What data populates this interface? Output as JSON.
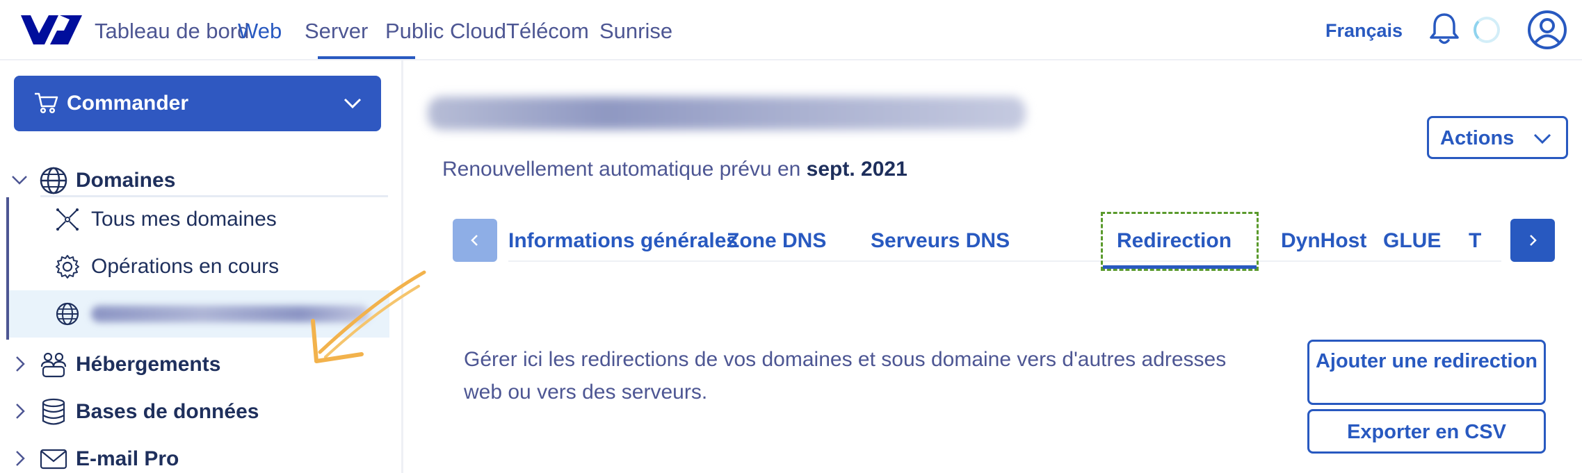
{
  "topnav": {
    "items": [
      {
        "label": "Tableau de bord",
        "active": false
      },
      {
        "label": "Web",
        "active": true
      },
      {
        "label": "Server",
        "active": false
      },
      {
        "label": "Public Cloud",
        "active": false
      },
      {
        "label": "Télécom",
        "active": false
      },
      {
        "label": "Sunrise",
        "active": false
      }
    ],
    "language": "Français",
    "icons": [
      "ovh-logo-icon",
      "bell-icon",
      "loading-spinner-icon",
      "user-account-icon"
    ]
  },
  "sidebar": {
    "order_button": {
      "label": "Commander",
      "icon": "cart-icon",
      "chevron": "chevron-down-icon"
    },
    "sections": [
      {
        "label": "Domaines",
        "icon": "globe-icon",
        "expanded": true,
        "children": [
          {
            "label": "Tous mes domaines",
            "icon": "network-icon"
          },
          {
            "label": "Opérations en cours",
            "icon": "gear-icon"
          }
        ]
      },
      {
        "label": "Hébergements",
        "icon": "hosting-icon",
        "expanded": false
      },
      {
        "label": "Bases de données",
        "icon": "database-icon",
        "expanded": false
      },
      {
        "label": "E-mail Pro",
        "icon": "envelope-icon",
        "expanded": false
      }
    ]
  },
  "main": {
    "renewal": {
      "prefix": "Renouvellement automatique prévu en ",
      "date": "sept. 2021"
    },
    "actions_button": "Actions",
    "tabs": [
      {
        "label": "Informations générales",
        "active": false
      },
      {
        "label": "Zone DNS",
        "active": false
      },
      {
        "label": "Serveurs DNS",
        "active": false
      },
      {
        "label": "Redirection",
        "active": true
      },
      {
        "label": "DynHost",
        "active": false
      },
      {
        "label": "GLUE",
        "active": false
      },
      {
        "label": "T",
        "active": false
      }
    ],
    "description": "Gérer ici les redirections de vos domaines et sous domaine vers d'autres adresses web ou vers des serveurs.",
    "buttons": {
      "add_redirection": "Ajouter une redirection",
      "export_csv": "Exporter en CSV"
    }
  },
  "colors": {
    "primary": "#2859c0",
    "text": "#4d5693",
    "heading": "#1e2f5c",
    "order_button_bg": "#2f58c1",
    "selected_row_bg": "#e9f3fb",
    "highlight_dashed": "#5a9a2c",
    "annotation_arrow": "#f2b24c"
  }
}
